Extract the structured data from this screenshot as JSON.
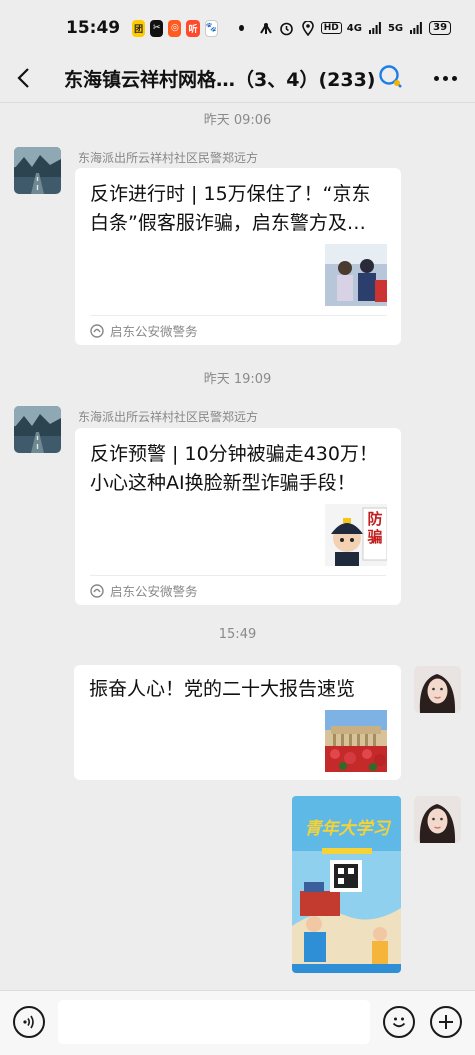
{
  "status": {
    "time": "15:49",
    "battery": "39",
    "network": "4G",
    "network2": "5G",
    "hd": "HD"
  },
  "header": {
    "title": "东海镇云祥村网格…（3、4）(233)"
  },
  "messages": {
    "ts1": "昨天 09:06",
    "m1": {
      "sender": "东海派出所云祥村社区民警郑远方",
      "title": "反诈进行时 | 15万保住了！“京东白条”假客服诈骗，启东警方及…",
      "source": "启东公安微警务"
    },
    "ts2": "昨天 19:09",
    "m2": {
      "sender": "东海派出所云祥村社区民警郑远方",
      "title": "反诈预警 | 10分钟被骗走430万！小心这种AI换脸新型诈骗手段！",
      "source": "启东公安微警务",
      "thumb_text": "防骗"
    },
    "ts3": "15:49",
    "m3": {
      "title": "振奋人心！党的二十大报告速览"
    },
    "m4": {
      "poster_title": "青年大学习"
    }
  },
  "colors": {
    "background": "#ededed",
    "card": "#ffffff",
    "accent_blue": "#1e7ee8"
  }
}
